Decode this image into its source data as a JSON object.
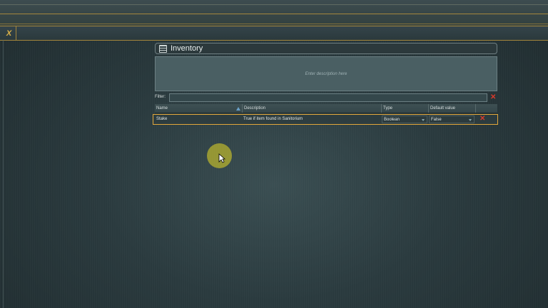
{
  "toolbar": {
    "close_tab_label": "X"
  },
  "panel": {
    "title": "Inventory",
    "description_placeholder": "Enter description here",
    "filter_label": "Filter:",
    "filter_value": "",
    "clear_filter_label": "✕"
  },
  "grid": {
    "columns": [
      "Name",
      "Description",
      "Type",
      "Default value"
    ],
    "rows": [
      {
        "name": "Stake",
        "description": "True if item found in Sanitorium",
        "type": "Boolean",
        "default": "False",
        "delete_label": "✕"
      }
    ]
  },
  "colors": {
    "accent": "#e2a73a",
    "delete": "#d93a2b",
    "cursor_highlight": "#d2c828"
  },
  "icons": [
    "list-icon",
    "sort-ascending-icon",
    "dropdown-arrow-icon",
    "close-icon",
    "mouse-pointer-icon"
  ]
}
